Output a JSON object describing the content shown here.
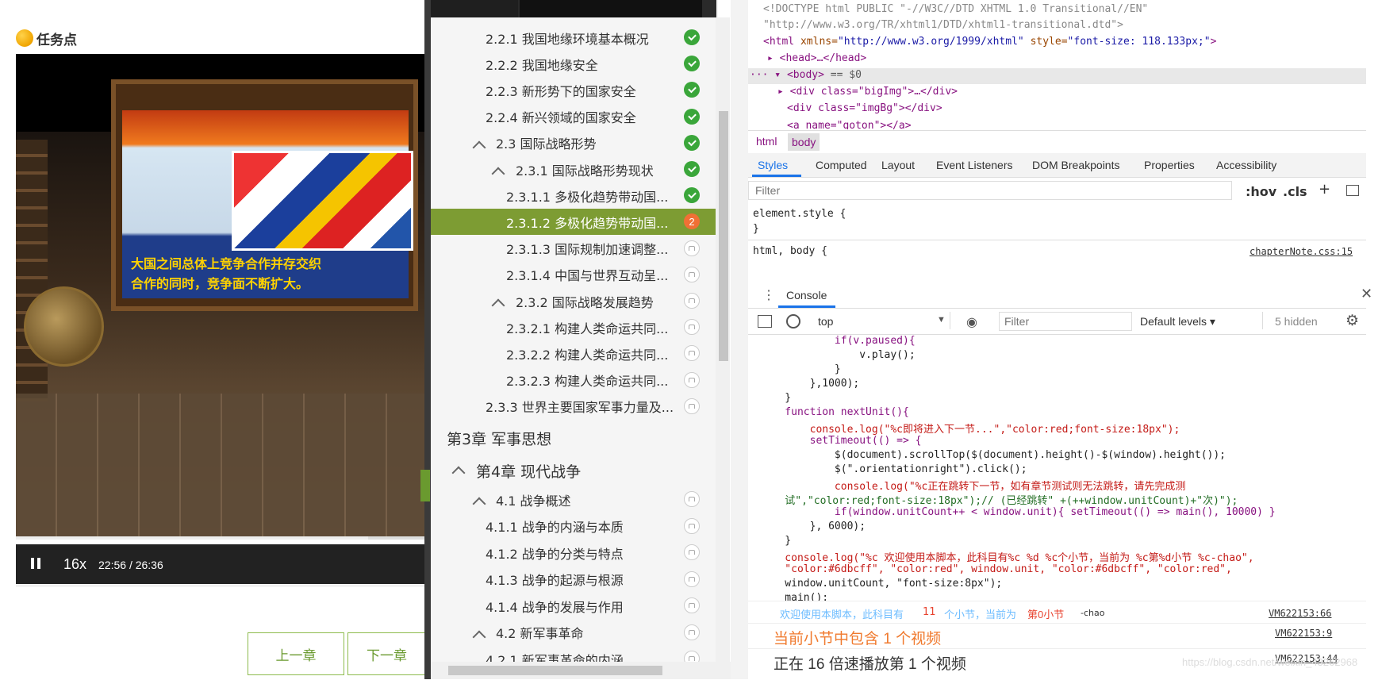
{
  "left": {
    "task_title": "任务点",
    "video": {
      "subtitle_line1": "大国之间总体上竞争合作并存交织",
      "subtitle_line2": "合作的同时，竞争面不断扩大。",
      "speed": "16x",
      "current_time": "22:56",
      "time_sep": "/",
      "duration": "26:36",
      "progress_fraction": 0.862
    },
    "prev_chapter": "上一章",
    "next_chapter": "下一章"
  },
  "tree": {
    "items": [
      {
        "label": "2.2.1 我国地缘环境基本概况",
        "status": "done"
      },
      {
        "label": "2.2.2 我国地缘安全",
        "status": "done"
      },
      {
        "label": "2.2.3 新形势下的国家安全",
        "status": "done"
      },
      {
        "label": "2.2.4 新兴领域的国家安全",
        "status": "done"
      },
      {
        "label": "2.3 国际战略形势",
        "status": "done"
      },
      {
        "label": "2.3.1 国际战略形势现状",
        "status": "done"
      },
      {
        "label": "2.3.1.1 多极化趋势带动国...",
        "status": "done"
      },
      {
        "label": "2.3.1.2 多极化趋势带动国...",
        "status": "current",
        "badge": "2"
      },
      {
        "label": "2.3.1.3 国际规制加速调整...",
        "status": "locked"
      },
      {
        "label": "2.3.1.4 中国与世界互动呈...",
        "status": "locked"
      },
      {
        "label": "2.3.2 国际战略发展趋势",
        "status": "locked"
      },
      {
        "label": "2.3.2.1 构建人类命运共同...",
        "status": "locked"
      },
      {
        "label": "2.3.2.2 构建人类命运共同...",
        "status": "locked"
      },
      {
        "label": "2.3.2.3 构建人类命运共同...",
        "status": "locked"
      },
      {
        "label": "2.3.3 世界主要国家军事力量及...",
        "status": "locked"
      }
    ],
    "chapter3": "第3章 军事思想",
    "chapter4": "第4章 现代战争",
    "items2": [
      {
        "label": "4.1 战争概述",
        "status": "locked"
      },
      {
        "label": "4.1.1 战争的内涵与本质",
        "status": "locked"
      },
      {
        "label": "4.1.2 战争的分类与特点",
        "status": "locked"
      },
      {
        "label": "4.1.3 战争的起源与根源",
        "status": "locked"
      },
      {
        "label": "4.1.4 战争的发展与作用",
        "status": "locked"
      },
      {
        "label": "4.2 新军事革命",
        "status": "locked"
      },
      {
        "label": "4.2.1 新军事革命的内涵",
        "status": "locked"
      }
    ]
  },
  "devtools": {
    "elements": {
      "l1": "<!DOCTYPE html PUBLIC \"-//W3C//DTD XHTML 1.0 Transitional//EN\"",
      "l2": "\"http://www.w3.org/TR/xhtml1/DTD/xhtml1-transitional.dtd\">",
      "l3_tag": "<html",
      "l3_attr": " xmlns=",
      "l3_val": "\"http://www.w3.org/1999/xhtml\"",
      "l3_attr2": " style=",
      "l3_val2": "\"font-size: 118.133px;\"",
      "l3_end": ">",
      "l4": "<head>…</head>",
      "l5": "<body>",
      "l5b": " == $0",
      "l6": "<div class=\"bigImg\">…</div>",
      "l7": "<div class=\"imgBg\"></div>",
      "l8": "<a name=\"goton\"></a>"
    },
    "crumbs": [
      "html",
      "body"
    ],
    "subtabs": [
      "Styles",
      "Computed",
      "Layout",
      "Event Listeners",
      "DOM Breakpoints",
      "Properties",
      "Accessibility"
    ],
    "filter_placeholder": "Filter",
    "hov": ":hov",
    "cls": ".cls",
    "element_style": "element.style {",
    "close_brace": "}",
    "html_body": "html, body {",
    "source_link": "chapterNote.css:15",
    "console_tab": "Console",
    "context": "top",
    "console_filter": "Filter",
    "levels": "Default levels",
    "hidden": "5 hidden",
    "code": [
      "            if(v.paused){",
      "                v.play();",
      "            }",
      "        },1000);",
      "    }",
      "    function nextUnit(){",
      "        console.log(\"%c即将进入下一节...\",\"color:red;font-size:18px\");",
      "        setTimeout(() => {",
      "            $(document).scrollTop($(document).height()-$(window).height());",
      "            $(\".orientationright\").click();",
      "            console.log(\"%c正在跳转下一节，如有章节测试则无法跳转，请先完成测",
      "    试\",\"color:red;font-size:18px\");// (已经跳转\" +(++window.unitCount)+\"次)\");",
      "            if(window.unitCount++ < window.unit){ setTimeout(() => main(), 10000) }",
      "        }, 6000);",
      "    }",
      "    console.log(\"%c 欢迎使用本脚本，此科目有%c %d %c个小节，当前为 %c第%d小节 %c-chao\",",
      "    \"color:#6dbcff\", \"color:red\", window.unit, \"color:#6dbcff\", \"color:red\",",
      "    window.unitCount, \"font-size:8px\");",
      "    main();"
    ],
    "log1": {
      "a": "欢迎使用本脚本，此科目有",
      "b": "11",
      "c": "个小节，当前为",
      "d": "第0小节",
      "e": "-chao",
      "src": "VM622153:66"
    },
    "log2": {
      "text": "当前小节中包含 1 个视频",
      "src": "VM622153:9"
    },
    "log3": {
      "text": "正在 16 倍速播放第 1 个视频",
      "src": "VM622153:44"
    }
  },
  "watermark": "https://blog.csdn.net/weixin_43262968",
  "colors": {
    "accent_green": "#7d9c33",
    "done_green": "#3aa63a",
    "current_orange": "#f07035",
    "log_blue": "#6dbcff",
    "log_red": "#e8432f"
  }
}
